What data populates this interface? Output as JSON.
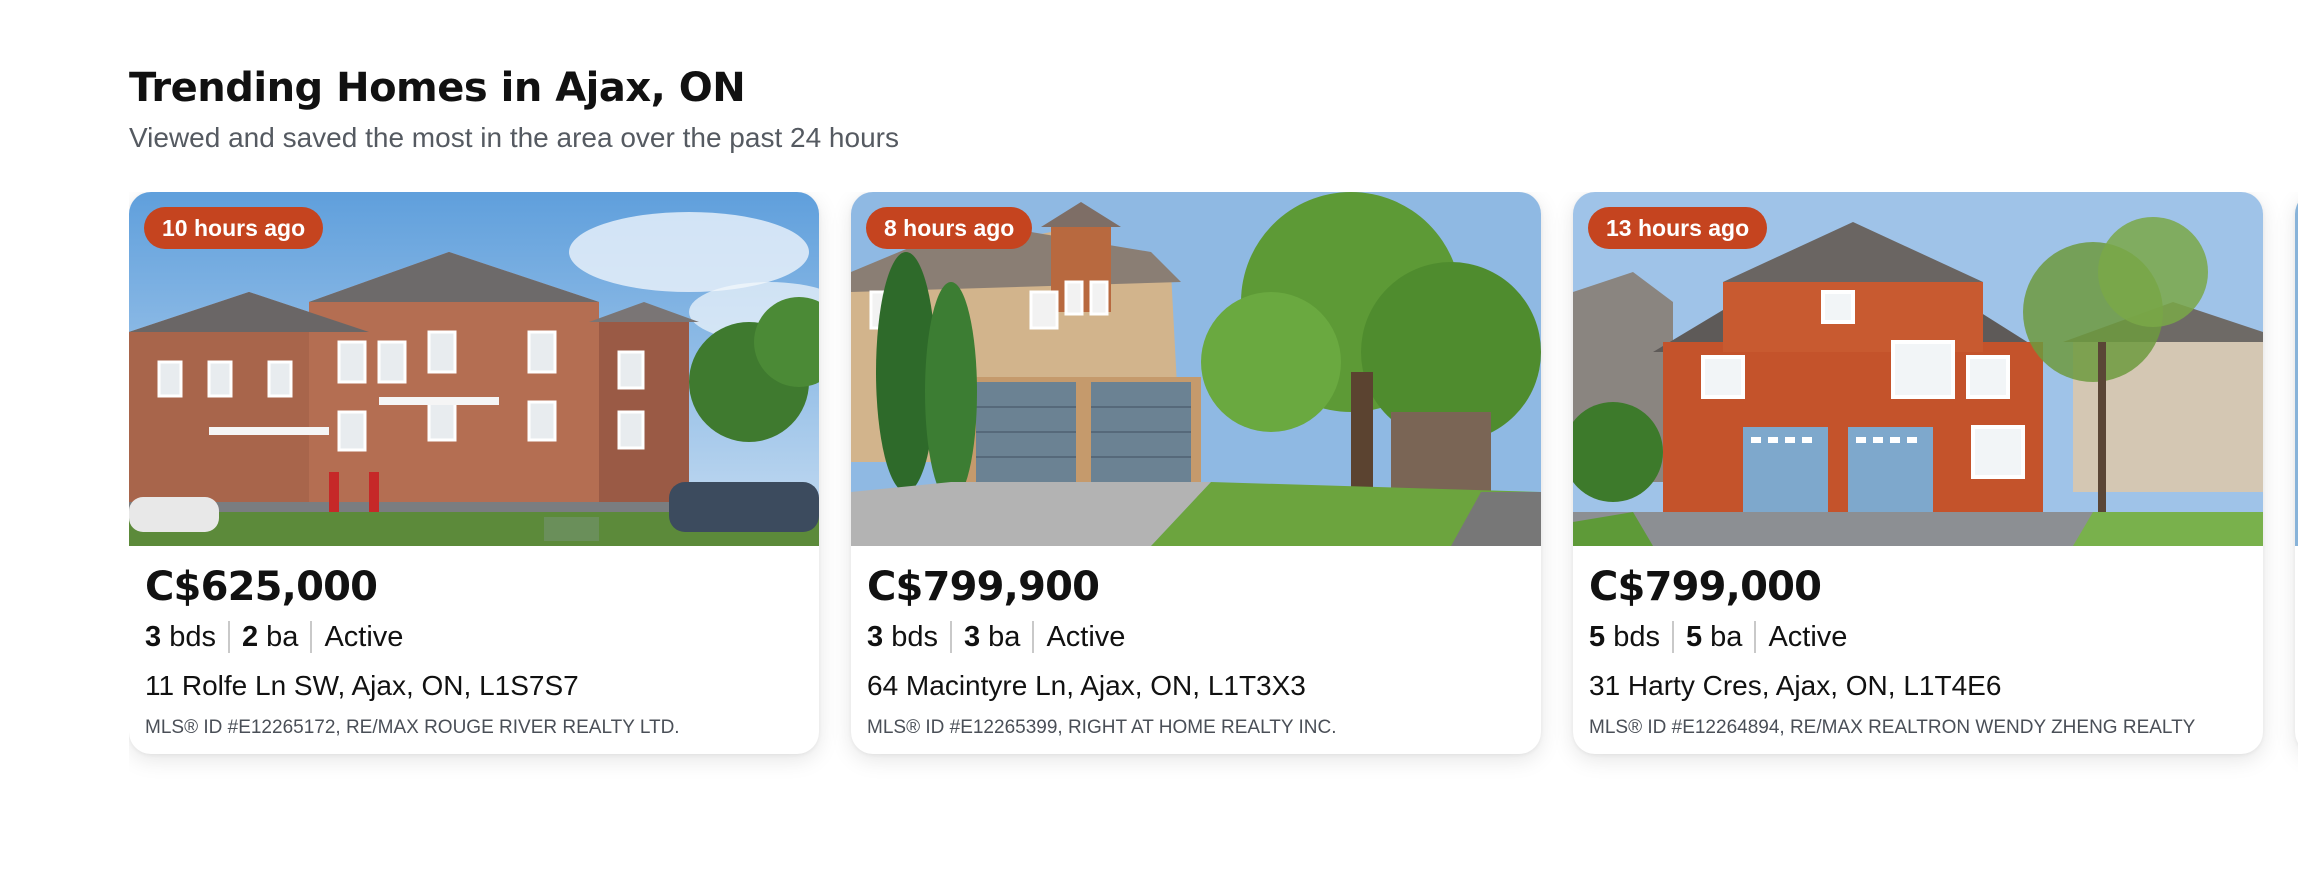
{
  "header": {
    "title": "Trending Homes in Ajax, ON",
    "subtitle": "Viewed and saved the most in the area over the past 24 hours"
  },
  "colors": {
    "badge": "#c5441f",
    "text_primary": "#111111",
    "text_secondary": "#555a61"
  },
  "listings": [
    {
      "badge": "10 hours ago",
      "price": "C$625,000",
      "beds": "3",
      "beds_label": "bds",
      "baths": "2",
      "baths_label": "ba",
      "status": "Active",
      "address": "11 Rolfe Ln SW, Ajax, ON, L1S7S7",
      "mls": "MLS® ID #E12265172, RE/MAX ROUGE RIVER REALTY LTD."
    },
    {
      "badge": "8 hours ago",
      "price": "C$799,900",
      "beds": "3",
      "beds_label": "bds",
      "baths": "3",
      "baths_label": "ba",
      "status": "Active",
      "address": "64 Macintyre Ln, Ajax, ON, L1T3X3",
      "mls": "MLS® ID #E12265399, RIGHT AT HOME REALTY INC."
    },
    {
      "badge": "13 hours ago",
      "price": "C$799,000",
      "beds": "5",
      "beds_label": "bds",
      "baths": "5",
      "baths_label": "ba",
      "status": "Active",
      "address": "31 Harty Cres, Ajax, ON, L1T4E6",
      "mls": "MLS® ID #E12264894, RE/MAX REALTRON WENDY ZHENG REALTY"
    }
  ]
}
